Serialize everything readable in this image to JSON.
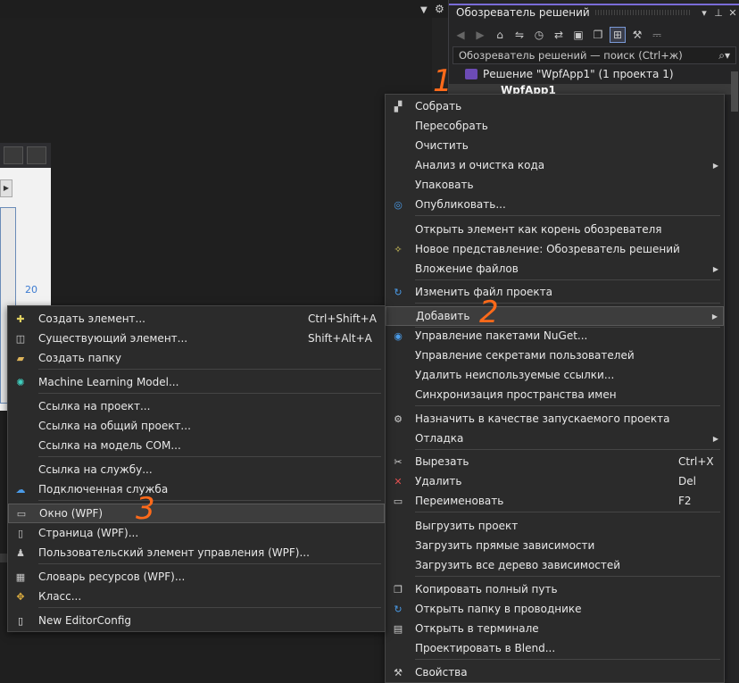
{
  "editor": {
    "zoom_text": "20"
  },
  "solution_explorer": {
    "title": "Обозреватель решений",
    "search_placeholder": "Обозреватель решений — поиск (Ctrl+ж)",
    "solution_label": "Решение \"WpfApp1\"  (1 проекта 1)",
    "project_label": "WpfApp1"
  },
  "main_menu": {
    "items": [
      {
        "label": "Собрать",
        "icon": "build-icon"
      },
      {
        "label": "Пересобрать"
      },
      {
        "label": "Очистить"
      },
      {
        "label": "Анализ и очистка кода",
        "submenu": true
      },
      {
        "label": "Упаковать"
      },
      {
        "label": "Опубликовать...",
        "icon": "globe-icon"
      },
      {
        "label": "Открыть элемент как корень обозревателя"
      },
      {
        "label": "Новое представление: Обозреватель решений",
        "icon": "new-view-icon"
      },
      {
        "label": "Вложение файлов",
        "submenu": true
      },
      {
        "label": "Изменить файл проекта",
        "icon": "edit-arrow-icon"
      },
      {
        "label": "Добавить",
        "submenu": true,
        "highlighted": true
      },
      {
        "label": "Управление пакетами NuGet...",
        "icon": "nuget-icon"
      },
      {
        "label": "Управление секретами пользователей"
      },
      {
        "label": "Удалить неиспользуемые ссылки..."
      },
      {
        "label": "Синхронизация пространства имен"
      },
      {
        "label": "Назначить в качестве запускаемого проекта",
        "icon": "gear-icon"
      },
      {
        "label": "Отладка",
        "submenu": true
      },
      {
        "label": "Вырезать",
        "shortcut": "Ctrl+X",
        "icon": "scissors-icon"
      },
      {
        "label": "Удалить",
        "shortcut": "Del",
        "icon": "delete-x-icon"
      },
      {
        "label": "Переименовать",
        "shortcut": "F2",
        "icon": "rename-icon"
      },
      {
        "label": "Выгрузить проект"
      },
      {
        "label": "Загрузить прямые зависимости"
      },
      {
        "label": "Загрузить все дерево зависимостей"
      },
      {
        "label": "Копировать полный путь",
        "icon": "copy-icon"
      },
      {
        "label": "Открыть папку в проводнике",
        "icon": "open-folder-arrow-icon"
      },
      {
        "label": "Открыть в терминале",
        "icon": "terminal-icon"
      },
      {
        "label": "Проектировать в Blend..."
      },
      {
        "label": "Свойства",
        "icon": "wrench-icon"
      }
    ]
  },
  "add_menu": {
    "items": [
      {
        "label": "Создать элемент...",
        "shortcut": "Ctrl+Shift+A",
        "icon": "new-item-icon"
      },
      {
        "label": "Существующий элемент...",
        "shortcut": "Shift+Alt+A",
        "icon": "existing-item-icon"
      },
      {
        "label": "Создать папку",
        "icon": "folder-icon"
      },
      {
        "label": "Machine Learning Model...",
        "icon": "ml-model-icon"
      },
      {
        "label": "Ссылка на проект..."
      },
      {
        "label": "Ссылка на общий проект..."
      },
      {
        "label": "Ссылка на модель COM..."
      },
      {
        "label": "Ссылка на службу..."
      },
      {
        "label": "Подключенная служба",
        "icon": "cloud-service-icon"
      },
      {
        "label": "Окно (WPF)",
        "icon": "wpf-window-icon",
        "highlighted": true
      },
      {
        "label": "Страница (WPF)...",
        "icon": "wpf-page-icon"
      },
      {
        "label": "Пользовательский элемент управления (WPF)...",
        "icon": "user-control-icon"
      },
      {
        "label": "Словарь ресурсов (WPF)...",
        "icon": "resource-dictionary-icon"
      },
      {
        "label": "Класс...",
        "icon": "class-icon"
      },
      {
        "label": "New EditorConfig",
        "icon": "editorconfig-icon"
      }
    ]
  },
  "annotations": [
    "1",
    "2",
    "3"
  ]
}
